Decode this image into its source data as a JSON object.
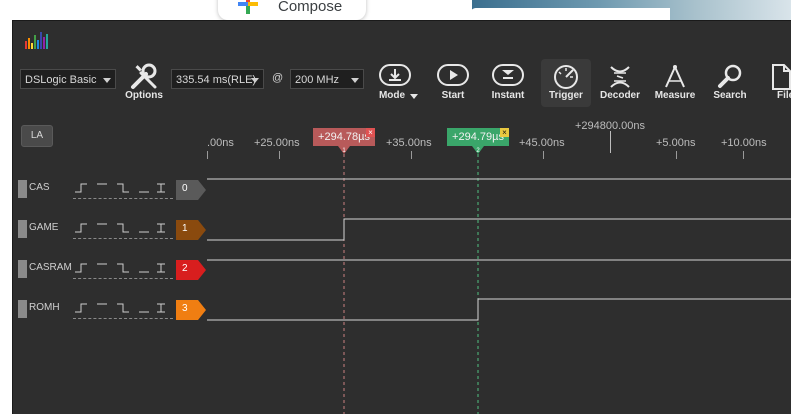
{
  "background": {
    "compose_label": "Compose"
  },
  "toolbar": {
    "device": "DSLogic Basic",
    "duration": "335.54 ms(RLE)",
    "at": "@",
    "samplerate": "200 MHz",
    "buttons": {
      "options": "Options",
      "mode": "Mode",
      "start": "Start",
      "instant": "Instant",
      "trigger": "Trigger",
      "decoder": "Decoder",
      "measure": "Measure",
      "search": "Search",
      "file": "File"
    }
  },
  "la_button": "LA",
  "ruler": {
    "offset_label": "+294800.00ns",
    "ticks": [
      ".00ns",
      "+25.00ns",
      "+35.00ns",
      "+45.00ns",
      "+5.00ns",
      "+10.00ns"
    ]
  },
  "cursors": [
    {
      "label": "+294.78µs",
      "close": "×",
      "marker": "1",
      "color": "#b85a5a"
    },
    {
      "label": "+294.79µs",
      "close": "×",
      "marker": "2",
      "color": "#3aa66a"
    }
  ],
  "channels": [
    {
      "name": "CAS",
      "index": "0",
      "color": "#5a5a5a"
    },
    {
      "name": "GAME",
      "index": "1",
      "color": "#8a4a0e"
    },
    {
      "name": "CASRAM",
      "index": "2",
      "color": "#d81e1e"
    },
    {
      "name": "ROMH",
      "index": "3",
      "color": "#f07e12"
    }
  ],
  "colors": {
    "app_bg": "#2e2e2e",
    "signal": "#d6d6d6"
  }
}
